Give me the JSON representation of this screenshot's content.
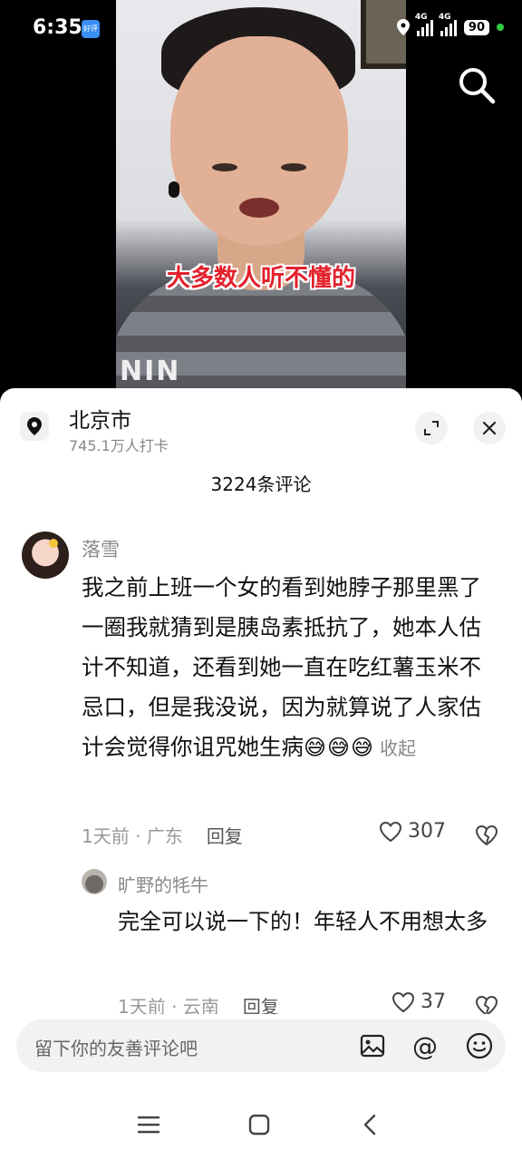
{
  "status_bar": {
    "time": "6:35",
    "app_badge": "好评",
    "network_1": "4G",
    "network_2": "4G",
    "battery": "90"
  },
  "video": {
    "subtitle": "大多数人听不懂的",
    "sweater_text": "NIN"
  },
  "location": {
    "title": "北京市",
    "subtitle": "745.1万人打卡"
  },
  "comments_header": {
    "count": "3224条评论"
  },
  "comment": {
    "username": "落雪",
    "text": "我之前上班一个女的看到她脖子那里黑了一圈我就猜到是胰岛素抵抗了，她本人估计不知道，还看到她一直在吃红薯玉米不忌口，但是我没说，因为就算说了人家估计会觉得你诅咒她生病",
    "emojis": "😅😅😅",
    "collapse_label": "收起",
    "time": "1天前",
    "region": "· 广东",
    "reply_label": "回复",
    "likes": "307"
  },
  "reply": {
    "username": "旷野的牦牛",
    "text": "完全可以说一下的！年轻人不用想太多",
    "time": "1天前",
    "region": "· 云南",
    "reply_label": "回复",
    "likes": "37"
  },
  "input": {
    "placeholder": "留下你的友善评论吧"
  },
  "colors": {
    "subtitle_red": "#e3212c",
    "status_dot": "#2ecc40"
  },
  "icons": [
    "search-icon",
    "location-pin-icon",
    "expand-icon",
    "close-icon",
    "heart-icon",
    "broken-heart-icon",
    "image-icon",
    "at-icon",
    "emoji-icon",
    "menu-icon",
    "home-icon",
    "back-icon"
  ]
}
